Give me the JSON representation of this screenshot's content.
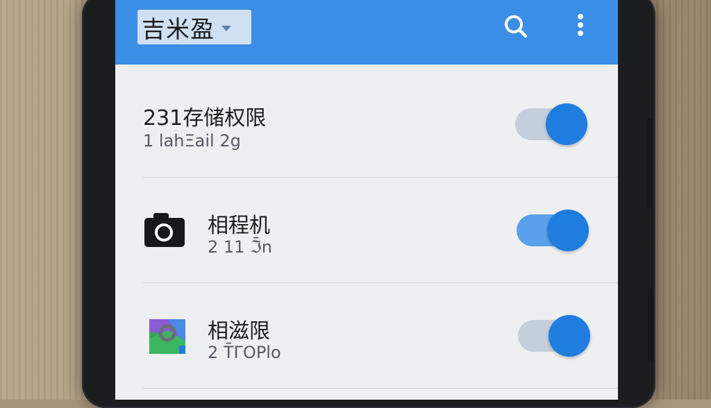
{
  "app_bar": {
    "title": "吉米盈",
    "search_icon": "search-icon",
    "menu_icon": "more-vert-icon",
    "color": "#3b8ee6"
  },
  "permissions": [
    {
      "title": "231存储权限",
      "subtitle": "1 lahΞail  2g",
      "enabled": true,
      "icon": ""
    },
    {
      "title": "相程机",
      "subtitle": "2 11 ℑ̄̄n",
      "enabled": true,
      "icon": "camera-icon"
    },
    {
      "title": "相滋限",
      "subtitle": "2 T̄ΓOPlo",
      "enabled": true,
      "icon": "photos-icon"
    }
  ],
  "colors": {
    "accent": "#1f7de0",
    "track_on_light": "#c5cfdb",
    "track_on": "#5aa0ea"
  }
}
